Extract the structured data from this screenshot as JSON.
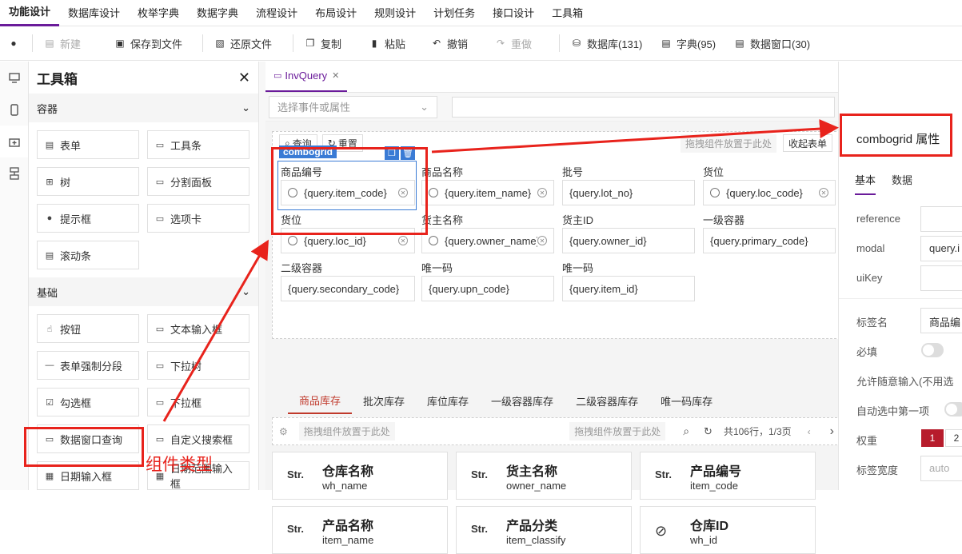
{
  "menu": [
    "功能设计",
    "数据库设计",
    "枚举字典",
    "数据字典",
    "流程设计",
    "布局设计",
    "规则设计",
    "计划任务",
    "接口设计",
    "工具箱"
  ],
  "toolbar": {
    "new": "新建",
    "save_file": "保存到文件",
    "restore_file": "还原文件",
    "copy": "复制",
    "paste": "粘贴",
    "undo": "撤销",
    "redo": "重做",
    "database": "数据库(131)",
    "dict": "字典(95)",
    "data_window": "数据窗口(30)"
  },
  "toolbox": {
    "title": "工具箱",
    "sections": {
      "container": "容器",
      "basic": "基础"
    },
    "container_items": [
      "表单",
      "工具条",
      "树",
      "分割面板",
      "提示框",
      "选项卡",
      "滚动条"
    ],
    "basic_items": [
      "按钮",
      "文本输入框",
      "表单强制分段",
      "下拉树",
      "勾选框",
      "下拉框",
      "数据窗口查询",
      "自定义搜索框",
      "日期输入框",
      "日期范围输入框"
    ]
  },
  "annotation": {
    "component_type": "组件类型"
  },
  "main": {
    "tab": "InvQuery",
    "event_placeholder": "选择事件或属性",
    "form": {
      "query_btn": "查询",
      "reset_btn": "重置",
      "drop_hint": "拖拽组件放置于此处",
      "collapse": "收起表单",
      "combo_tag": "combogrid",
      "fields": [
        {
          "label": "商品编号",
          "value": "{query.item_code}"
        },
        {
          "label": "商品名称",
          "value": "{query.item_name}"
        },
        {
          "label": "批号",
          "value": "{query.lot_no}"
        },
        {
          "label": "货位",
          "value": "{query.loc_code}"
        },
        {
          "label": "货位",
          "value": "{query.loc_id}"
        },
        {
          "label": "货主名称",
          "value": "{query.owner_name}"
        },
        {
          "label": "货主ID",
          "value": "{query.owner_id}"
        },
        {
          "label": "一级容器",
          "value": "{query.primary_code}"
        },
        {
          "label": "二级容器",
          "value": "{query.secondary_code}"
        },
        {
          "label": "唯一码",
          "value": "{query.upn_code}"
        },
        {
          "label": "唯一码",
          "value": "{query.item_id}"
        }
      ]
    },
    "subtabs": [
      "商品库存",
      "批次库存",
      "库位库存",
      "一级容器库存",
      "二级容器库存",
      "唯一码库存"
    ],
    "grid": {
      "drop_hint_left": "拖拽组件放置于此处",
      "drop_hint_right": "拖拽组件放置于此处",
      "total": "共106行，1/3页"
    },
    "cards": [
      {
        "type": "Str.",
        "title": "仓库名称",
        "sub": "wh_name"
      },
      {
        "type": "Str.",
        "title": "货主名称",
        "sub": "owner_name"
      },
      {
        "type": "Str.",
        "title": "产品编号",
        "sub": "item_code"
      },
      {
        "type": "Str.",
        "title": "产品名称",
        "sub": "item_name"
      },
      {
        "type": "Str.",
        "title": "产品分类",
        "sub": "item_classify"
      },
      {
        "type": "eye",
        "title": "仓库ID",
        "sub": "wh_id"
      }
    ]
  },
  "props": {
    "title": "combogrid 属性",
    "tabs": [
      "基本",
      "数据"
    ],
    "rows": {
      "reference": "reference",
      "modal": "modal",
      "modal_value": "query.i",
      "uikey": "uiKey",
      "label_name": "标签名",
      "label_value": "商品编",
      "required": "必填",
      "allow_input": "允许随意输入(不用选",
      "auto_select": "自动选中第一项",
      "weight": "权重",
      "weight_1": "1",
      "weight_2": "2",
      "label_width": "标签宽度",
      "label_width_value": "auto"
    }
  }
}
